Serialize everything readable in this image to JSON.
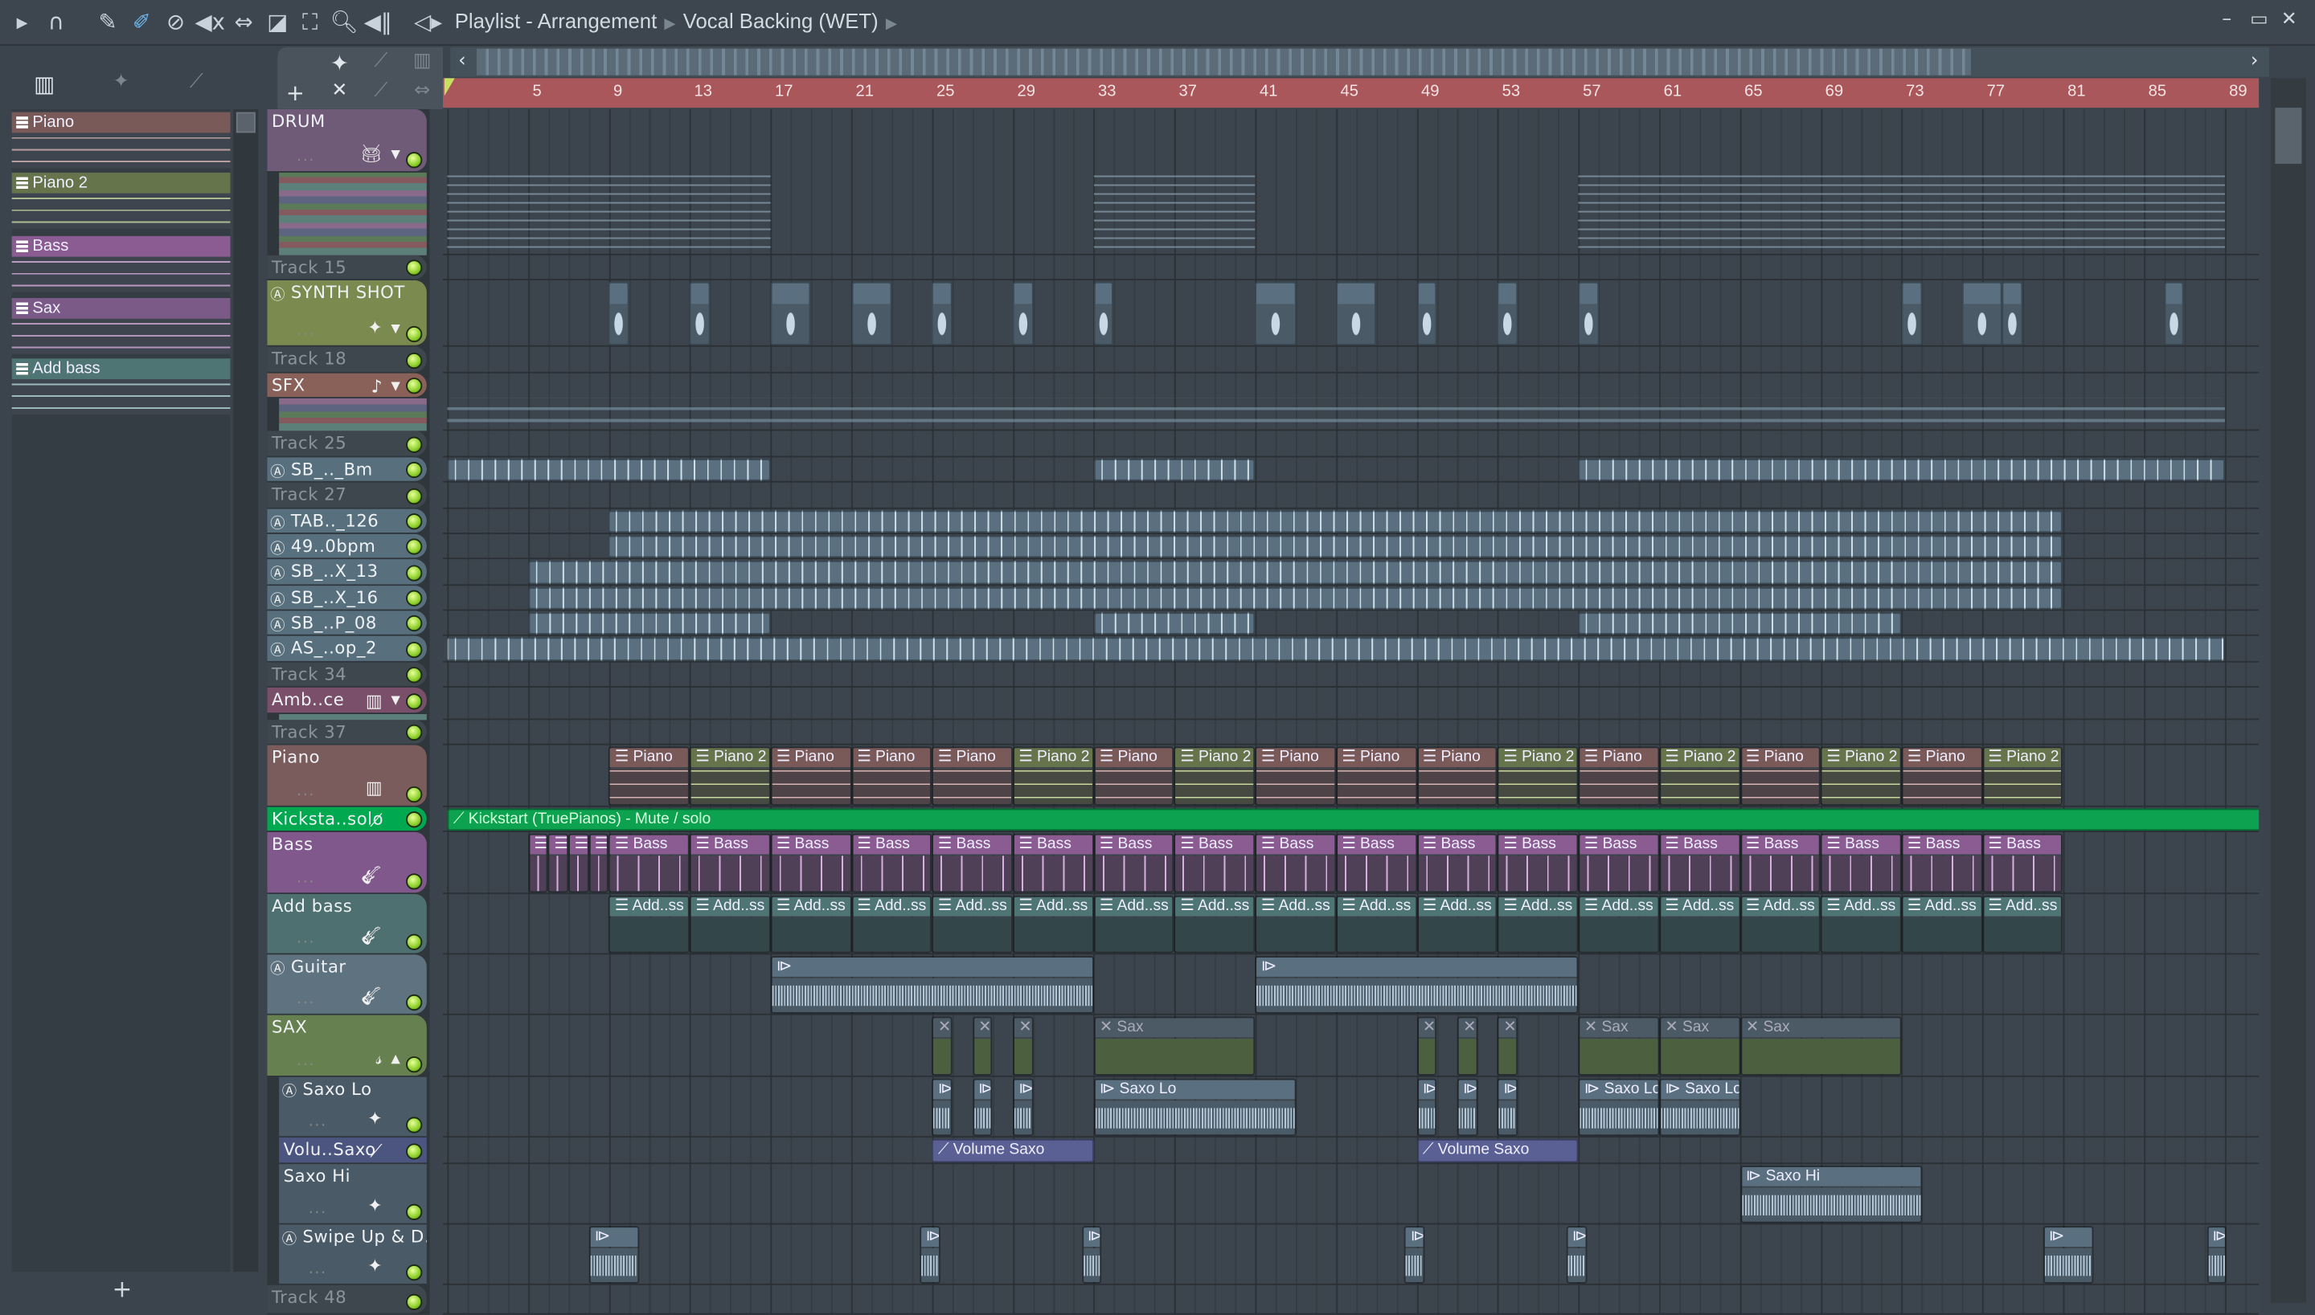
{
  "titlebar": {
    "title": "Playlist - Arrangement",
    "pattern": "Vocal Backing (WET)",
    "window_controls": [
      "minimize",
      "maximize",
      "close"
    ]
  },
  "toolbar_icons": [
    "play-arrow",
    "magnet",
    "pencil",
    "paint-brush",
    "delete",
    "mute",
    "slip",
    "slice",
    "select",
    "zoom",
    "playback"
  ],
  "picker": {
    "items": [
      {
        "label": "Piano",
        "color": "#d6b4b4",
        "header": "#7a5a58"
      },
      {
        "label": "Piano 2",
        "color": "#c8d8a0",
        "header": "#66744c"
      },
      {
        "label": "Bass",
        "color": "#d8b0e0",
        "header": "#8a5c92"
      },
      {
        "label": "Sax",
        "color": "#d0a8d8",
        "header": "#7c5a88"
      },
      {
        "label": "Add bass",
        "color": "#b0d8d8",
        "header": "#4e7474"
      }
    ],
    "add_label": "+"
  },
  "ruler": {
    "marks": [
      "5",
      "9",
      "13",
      "17",
      "21",
      "25",
      "29",
      "33",
      "37",
      "41",
      "45",
      "49",
      "53",
      "57",
      "61",
      "65",
      "69",
      "73",
      "77",
      "81",
      "85",
      "89"
    ]
  },
  "tracks": [
    {
      "name": "DRUM",
      "color": "#6f5a78",
      "icon": "drum"
    },
    {
      "name": "Track 15",
      "color": "#3f474e"
    },
    {
      "name": "SYNTH SHOT",
      "color": "#7b8a4e",
      "icon": "wave",
      "audio": true
    },
    {
      "name": "Track 18",
      "color": "#3f474e"
    },
    {
      "name": "SFX",
      "color": "#8a6158",
      "icon": "note"
    },
    {
      "name": "Track 25",
      "color": "#3f474e"
    },
    {
      "name": "SB_.._Bm",
      "color": "#58707e",
      "audio": true
    },
    {
      "name": "Track 27",
      "color": "#3f474e"
    },
    {
      "name": "TAB.._126",
      "color": "#58707e",
      "audio": true
    },
    {
      "name": "49..0bpm",
      "color": "#58707e",
      "audio": true
    },
    {
      "name": "SB_..X_13",
      "color": "#58707e",
      "audio": true
    },
    {
      "name": "SB_..X_16",
      "color": "#58707e",
      "audio": true
    },
    {
      "name": "SB_..P_08",
      "color": "#58707e",
      "audio": true
    },
    {
      "name": "AS_..op_2",
      "color": "#58707e",
      "audio": true
    },
    {
      "name": "Track 34",
      "color": "#3f474e"
    },
    {
      "name": "Amb..ce",
      "color": "#7a4f6a",
      "icon": "keys"
    },
    {
      "name": "Track 37",
      "color": "#3f474e"
    },
    {
      "name": "Piano",
      "color": "#7a5c5c",
      "icon": "piano"
    },
    {
      "name": "Kicksta..solo",
      "color": "#00a84f",
      "icon": "automation"
    },
    {
      "name": "Bass",
      "color": "#81588c",
      "icon": "guitar"
    },
    {
      "name": "Add bass",
      "color": "#4e7070",
      "icon": "guitar"
    },
    {
      "name": "Guitar",
      "color": "#5e7280",
      "icon": "guitar",
      "audio": true
    },
    {
      "name": "SAX",
      "color": "#66804f",
      "icon": "sax"
    },
    {
      "name": "Saxo Lo",
      "color": "#4a5a66",
      "icon": "wave",
      "audio": true
    },
    {
      "name": "Volu..Saxo",
      "color": "#4b5580",
      "icon": "automation"
    },
    {
      "name": "Saxo Hi",
      "color": "#4a5a66",
      "icon": "wave"
    },
    {
      "name": "Swipe Up & D..",
      "color": "#4a5a66",
      "icon": "wave",
      "audio": true
    },
    {
      "name": "Track 48",
      "color": "#3f474e"
    }
  ],
  "clips": [
    {
      "track": 0,
      "type": "drum",
      "start": 1,
      "len": 16
    },
    {
      "track": 0,
      "type": "drum",
      "start": 33,
      "len": 8
    },
    {
      "track": 0,
      "type": "drum",
      "start": 57,
      "len": 32
    },
    {
      "track": 4,
      "type": "sfx",
      "start": 1,
      "len": 88
    },
    {
      "track": 2,
      "type": "hit",
      "start": 9,
      "len": 1
    },
    {
      "track": 2,
      "type": "hit",
      "start": 13,
      "len": 1
    },
    {
      "track": 2,
      "type": "hit",
      "start": 17,
      "len": 2
    },
    {
      "track": 2,
      "type": "hit",
      "start": 21,
      "len": 2
    },
    {
      "track": 2,
      "type": "hit",
      "start": 25,
      "len": 1
    },
    {
      "track": 2,
      "type": "hit",
      "start": 29,
      "len": 1
    },
    {
      "track": 2,
      "type": "hit",
      "start": 33,
      "len": 1
    },
    {
      "track": 2,
      "type": "hit",
      "start": 41,
      "len": 2
    },
    {
      "track": 2,
      "type": "hit",
      "start": 45,
      "len": 2
    },
    {
      "track": 2,
      "type": "hit",
      "start": 49,
      "len": 1
    },
    {
      "track": 2,
      "type": "hit",
      "start": 53,
      "len": 1
    },
    {
      "track": 2,
      "type": "hit",
      "start": 57,
      "len": 1
    },
    {
      "track": 2,
      "type": "hit",
      "start": 73,
      "len": 1
    },
    {
      "track": 2,
      "type": "hit",
      "start": 76,
      "len": 2
    },
    {
      "track": 2,
      "type": "hit",
      "start": 78,
      "len": 1
    },
    {
      "track": 2,
      "type": "hit",
      "start": 86,
      "len": 1
    },
    {
      "track": 6,
      "type": "short",
      "start": 1,
      "len": 16
    },
    {
      "track": 6,
      "type": "short",
      "start": 33,
      "len": 8
    },
    {
      "track": 6,
      "type": "short",
      "start": 57,
      "len": 32
    },
    {
      "track": 8,
      "type": "short",
      "start": 9,
      "len": 72
    },
    {
      "track": 9,
      "type": "short",
      "start": 9,
      "len": 72
    },
    {
      "track": 10,
      "type": "short",
      "start": 5,
      "len": 76
    },
    {
      "track": 11,
      "type": "short",
      "start": 5,
      "len": 76
    },
    {
      "track": 12,
      "type": "short",
      "start": 5,
      "len": 12
    },
    {
      "track": 12,
      "type": "short",
      "start": 33,
      "len": 8
    },
    {
      "track": 12,
      "type": "short",
      "start": 57,
      "len": 16
    },
    {
      "track": 13,
      "type": "short",
      "start": 1,
      "len": 88
    },
    {
      "track": 17,
      "type": "piano",
      "start": 9,
      "len": 4,
      "labels": [
        "Piano",
        "Piano 2",
        "Piano",
        "Piano",
        "Piano",
        "Piano 2",
        "Piano",
        "Piano 2",
        "Piano",
        "Piano",
        "Piano",
        "Piano 2",
        "Piano",
        "Piano 2",
        "Piano",
        "Piano 2",
        "Piano",
        "Piano 2"
      ]
    },
    {
      "track": 18,
      "type": "kick",
      "start": 1,
      "len": 90,
      "labels": [
        "Kickstart (TruePianos) - Mute / solo"
      ]
    },
    {
      "track": 19,
      "type": "bass",
      "start": 5,
      "len": 1,
      "labels": [
        "",
        "",
        "",
        ""
      ]
    },
    {
      "track": 19,
      "type": "bass",
      "start": 9,
      "len": 4,
      "labels": [
        "Bass",
        "Bass",
        "Bass",
        "Bass",
        "Bass",
        "Bass",
        "Bass",
        "Bass",
        "Bass",
        "Bass",
        "Bass",
        "Bass",
        "Bass",
        "Bass",
        "Bass",
        "Bass",
        "Bass",
        "Bass"
      ]
    },
    {
      "track": 20,
      "type": "add",
      "start": 9,
      "len": 4,
      "labels": [
        "Add..ss",
        "Add..ss",
        "Add..ss",
        "Add..ss",
        "Add..ss",
        "Add..ss",
        "Add..ss",
        "Add..ss",
        "Add..ss",
        "Add..ss",
        "Add..ss",
        "Add..ss",
        "Add..ss",
        "Add..ss",
        "Add..ss",
        "Add..ss",
        "Add..ss",
        "Add..ss"
      ]
    },
    {
      "track": 21,
      "type": "audio",
      "start": 17,
      "len": 16,
      "labels": [
        ""
      ]
    },
    {
      "track": 21,
      "type": "audio",
      "start": 41,
      "len": 16,
      "labels": [
        ""
      ]
    },
    {
      "track": 22,
      "type": "sax",
      "start": 25,
      "len": 1,
      "labels": [
        "",
        "",
        ""
      ],
      "step": 2
    },
    {
      "track": 22,
      "type": "sax",
      "start": 33,
      "len": 8,
      "labels": [
        "Sax"
      ]
    },
    {
      "track": 22,
      "type": "sax",
      "start": 49,
      "len": 1,
      "labels": [
        "",
        "",
        ""
      ],
      "step": 2
    },
    {
      "track": 22,
      "type": "sax",
      "start": 57,
      "len": 4,
      "labels": [
        "Sax",
        "Sax"
      ]
    },
    {
      "track": 22,
      "type": "sax",
      "start": 65,
      "len": 8,
      "labels": [
        "Sax"
      ]
    },
    {
      "track": 23,
      "type": "audio",
      "start": 25,
      "len": 1,
      "labels": [
        "",
        "",
        ""
      ],
      "step": 2
    },
    {
      "track": 23,
      "type": "audio",
      "start": 33,
      "len": 10,
      "labels": [
        "Saxo Lo"
      ]
    },
    {
      "track": 23,
      "type": "audio",
      "start": 49,
      "len": 1,
      "labels": [
        "",
        "",
        ""
      ],
      "step": 2
    },
    {
      "track": 23,
      "type": "audio",
      "start": 57,
      "len": 4,
      "labels": [
        "Saxo Lo",
        "Saxo Lo"
      ]
    },
    {
      "track": 24,
      "type": "vol",
      "start": 25,
      "len": 8,
      "labels": [
        "Volume Saxo"
      ]
    },
    {
      "track": 24,
      "type": "vol",
      "start": 49,
      "len": 8,
      "labels": [
        "Volume Saxo"
      ]
    },
    {
      "track": 25,
      "type": "audio",
      "start": 65,
      "len": 9,
      "labels": [
        "Saxo Hi"
      ]
    },
    {
      "track": 26,
      "type": "audio",
      "start": 8,
      "len": 2.5,
      "labels": [
        ""
      ]
    },
    {
      "track": 26,
      "type": "audio",
      "start": 24.4,
      "len": 1,
      "labels": [
        ""
      ]
    },
    {
      "track": 26,
      "type": "audio",
      "start": 32.4,
      "len": 1,
      "labels": [
        ""
      ]
    },
    {
      "track": 26,
      "type": "audio",
      "start": 48.4,
      "len": 1,
      "labels": [
        ""
      ]
    },
    {
      "track": 26,
      "type": "audio",
      "start": 56.4,
      "len": 1,
      "labels": [
        ""
      ]
    },
    {
      "track": 26,
      "type": "audio",
      "start": 80,
      "len": 2.5,
      "labels": [
        ""
      ]
    },
    {
      "track": 26,
      "type": "audio",
      "start": 88.1,
      "len": 1,
      "labels": [
        ""
      ]
    }
  ]
}
